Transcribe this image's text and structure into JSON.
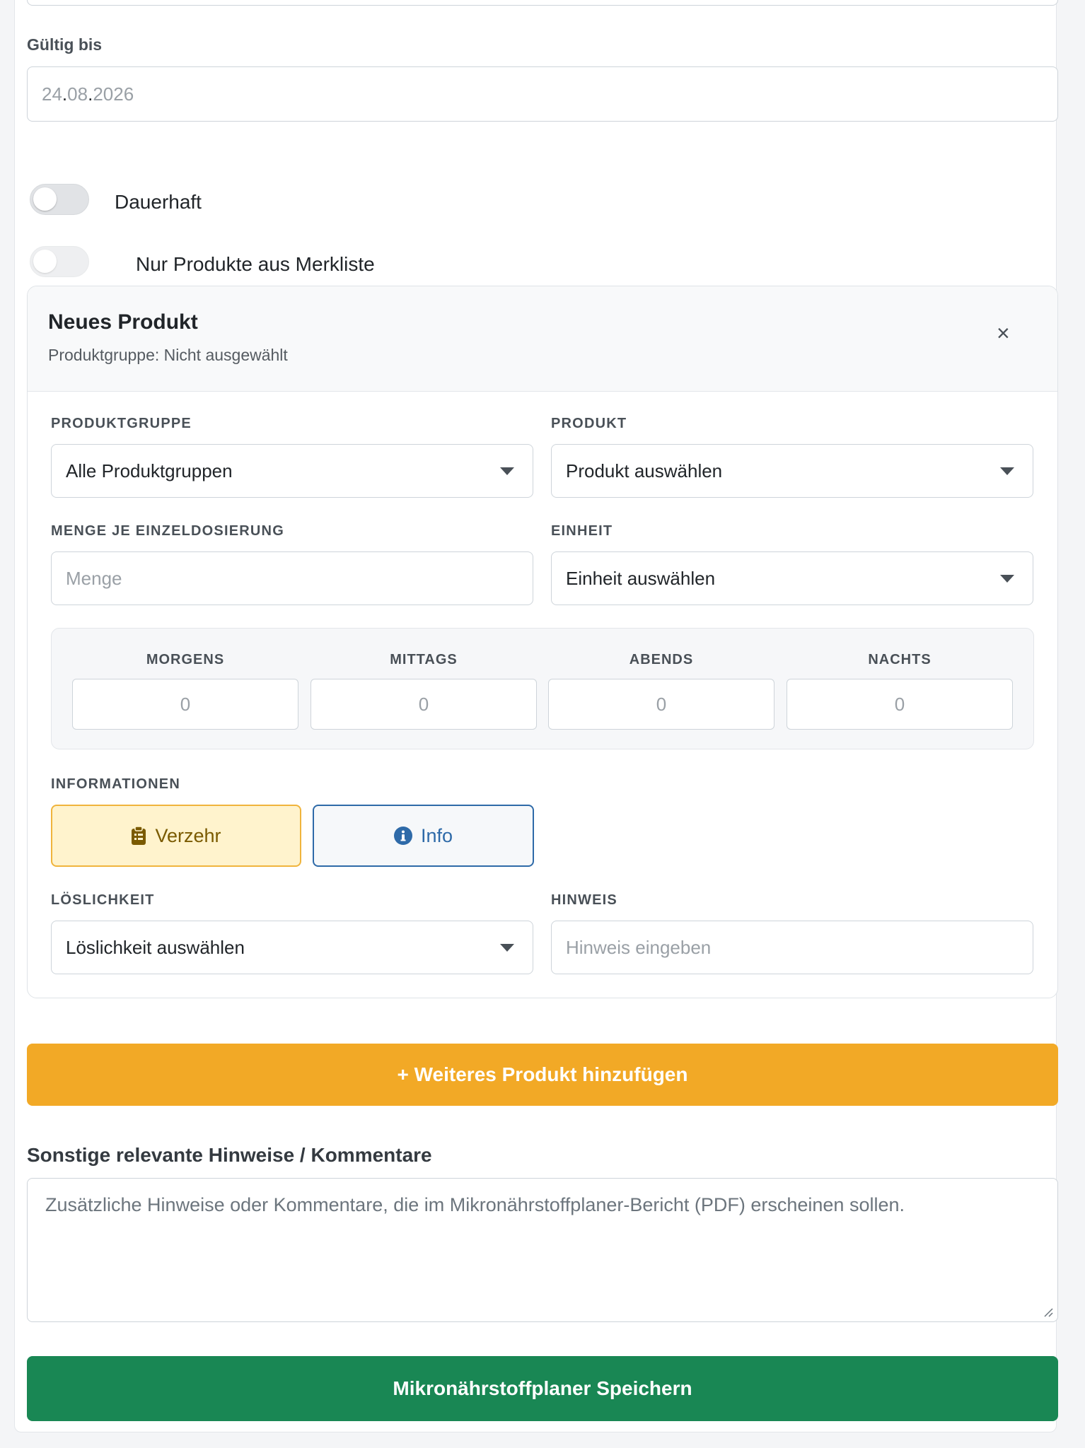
{
  "form": {
    "valid_until_label": "Gültig bis",
    "valid_until_day": "24",
    "valid_until_month": "08",
    "valid_until_year": "2026",
    "dot": ".",
    "toggle_permanent": "Dauerhaft",
    "toggle_wishlist": "Nur Produkte aus Merkliste"
  },
  "product_card": {
    "title": "Neues Produkt",
    "subtitle": "Produktgruppe: Nicht ausgewählt",
    "close_symbol": "×",
    "group_label": "PRODUKTGRUPPE",
    "group_value": "Alle Produktgruppen",
    "product_label": "PRODUKT",
    "product_value": "Produkt auswählen",
    "amount_label": "MENGE JE EINZELDOSIERUNG",
    "amount_placeholder": "Menge",
    "unit_label": "EINHEIT",
    "unit_value": "Einheit auswählen",
    "dosing": [
      {
        "label": "MORGENS",
        "value": "0"
      },
      {
        "label": "MITTAGS",
        "value": "0"
      },
      {
        "label": "ABENDS",
        "value": "0"
      },
      {
        "label": "NACHTS",
        "value": "0"
      }
    ],
    "info_label": "INFORMATIONEN",
    "btn_consumption": "Verzehr",
    "btn_info": "Info",
    "solubility_label": "LÖSLICHKEIT",
    "solubility_value": "Löslichkeit auswählen",
    "hint_label": "HINWEIS",
    "hint_placeholder": "Hinweis eingeben"
  },
  "actions": {
    "add_product": "+ Weiteres Produkt hinzufügen",
    "save": "Mikronährstoffplaner Speichern"
  },
  "comments": {
    "title": "Sonstige relevante Hinweise / Kommentare",
    "placeholder": "Zusätzliche Hinweise oder Kommentare, die im Mikronährstoffplaner-Bericht (PDF) erscheinen sollen."
  },
  "colors": {
    "primary_orange": "#f2a926",
    "save_green": "#198754",
    "info_blue": "#2e6aa8",
    "consumption_yellow": "#fff3cd"
  }
}
